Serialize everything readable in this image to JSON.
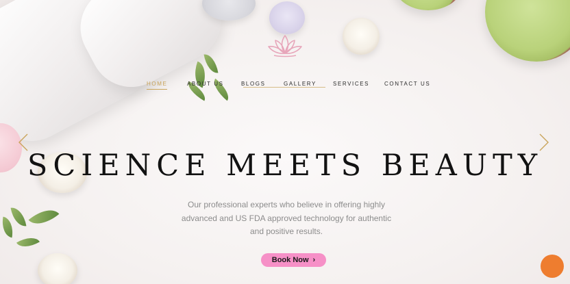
{
  "nav": {
    "items": [
      {
        "label": "HOME",
        "active": true
      },
      {
        "label": "ABOUT US",
        "active": false
      },
      {
        "label": "BLOGS",
        "active": false
      },
      {
        "label": "GALLERY",
        "active": false
      },
      {
        "label": "SERVICES",
        "active": false
      },
      {
        "label": "CONTACT US",
        "active": false
      }
    ]
  },
  "hero": {
    "title": "SCIENCE MEETS BEAUTY",
    "subtitle": "Our professional experts who believe in offering highly advanced and US FDA approved technology for authentic and positive results.",
    "cta_label": "Book Now",
    "cta_icon": "chevron-right-icon",
    "prev_icon": "chevron-left-icon",
    "next_icon": "chevron-right-icon"
  },
  "brand": {
    "logo_icon": "lotus-icon",
    "logo_color": "#e7a6ba"
  },
  "colors": {
    "accent": "#c9a45a",
    "cta_bg": "#f690c7",
    "chat_bg": "#ee7d2f"
  },
  "widgets": {
    "chat_icon": "chat-bubble-icon"
  }
}
